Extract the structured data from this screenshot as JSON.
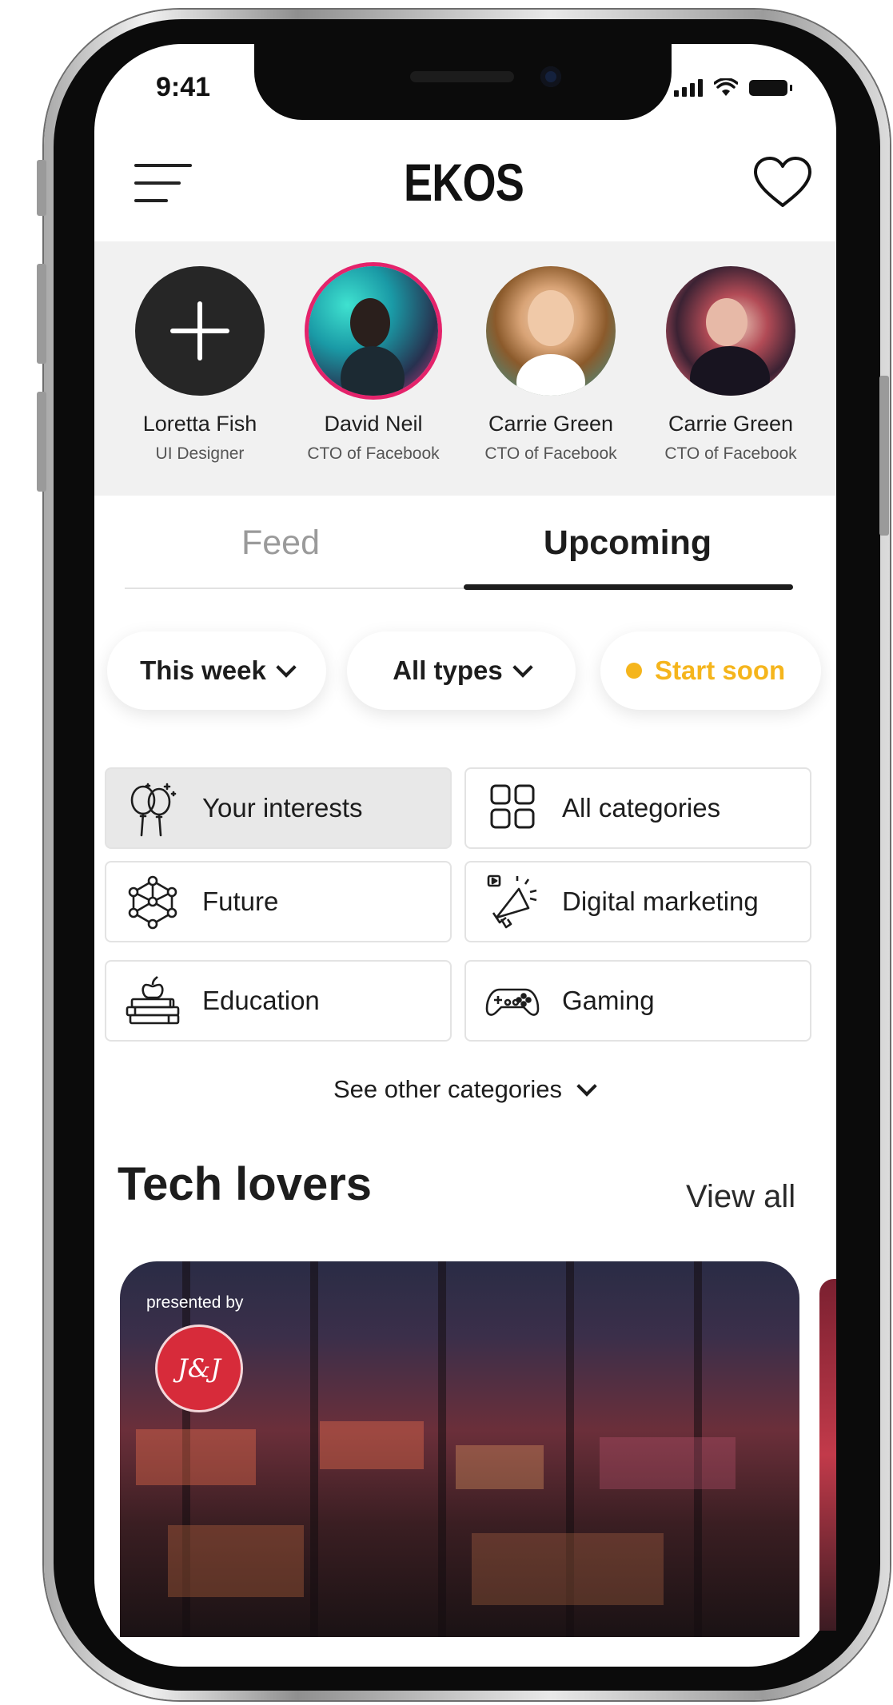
{
  "status_bar": {
    "time": "9:41"
  },
  "header": {
    "title": "EKOS",
    "menu_icon": "menu-icon",
    "favorite_icon": "heart-icon"
  },
  "stories": [
    {
      "name": "Loretta Fish",
      "role": "UI Designer",
      "type": "add"
    },
    {
      "name": "David Neil",
      "role": "CTO of Facebook",
      "type": "avatar"
    },
    {
      "name": "Carrie Green",
      "role": "CTO of Facebook",
      "type": "avatar"
    },
    {
      "name": "Carrie Green",
      "role": "CTO of Facebook",
      "type": "avatar"
    }
  ],
  "tabs": [
    {
      "label": "Feed",
      "active": false
    },
    {
      "label": "Upcoming",
      "active": true
    }
  ],
  "filters": [
    {
      "label": "This week",
      "icon": "chevron-down-icon"
    },
    {
      "label": "All types",
      "icon": "chevron-down-icon"
    },
    {
      "label": "Start soon",
      "icon": "status-dot",
      "color": "#f5b51c"
    }
  ],
  "categories": [
    {
      "label": "Your interests",
      "icon": "balloons-icon",
      "active": true
    },
    {
      "label": "All categories",
      "icon": "grid-icon",
      "active": false
    },
    {
      "label": "Future",
      "icon": "network-cube-icon",
      "active": false
    },
    {
      "label": "Digital marketing",
      "icon": "megaphone-icon",
      "active": false
    },
    {
      "label": "Education",
      "icon": "books-apple-icon",
      "active": false
    },
    {
      "label": "Gaming",
      "icon": "gamepad-icon",
      "active": false
    }
  ],
  "see_other": "See other categories",
  "section": {
    "title": "Tech lovers",
    "view_all": "View all"
  },
  "event_card": {
    "presented_by": "presented by",
    "brand_logo_text": "J&J"
  },
  "colors": {
    "accent": "#f5b51c",
    "story_ring": "#e4236b",
    "brand_logo": "#d72b3a"
  }
}
